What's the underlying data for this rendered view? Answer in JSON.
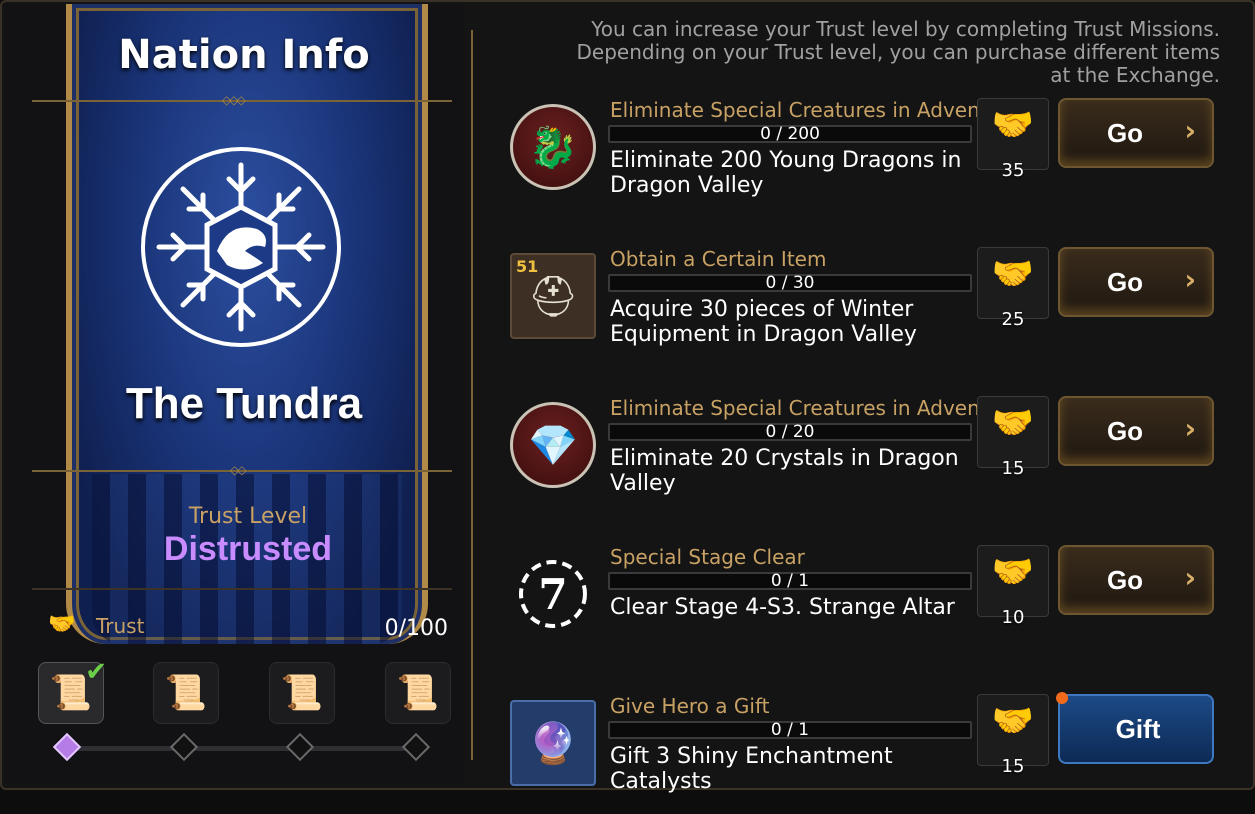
{
  "left": {
    "title": "Nation Info",
    "nation_name": "The Tundra",
    "trust_level_label": "Trust Level",
    "trust_level_value": "Distrusted",
    "trust_label": "Trust",
    "trust_count": "0/100",
    "trust_progress_fraction": 0
  },
  "info_text": "You can increase your Trust level by completing Trust Missions. Depending on your Trust level, you can purchase different items at the Exchange.",
  "missions": [
    {
      "category": "Eliminate Special Creatures in Adventure",
      "progress": "0 / 200",
      "description": "Eliminate 200 Young Dragons in Dragon Valley",
      "reward": "35",
      "button": "Go"
    },
    {
      "category": "Obtain a Certain Item",
      "badge": "51",
      "progress": "0 / 30",
      "description": "Acquire 30 pieces of Winter Equipment in Dragon Valley",
      "reward": "25",
      "button": "Go"
    },
    {
      "category": "Eliminate Special Creatures in Adventure",
      "progress": "0 / 20",
      "description": "Eliminate 20 Crystals in Dragon Valley",
      "reward": "15",
      "button": "Go"
    },
    {
      "category": "Special Stage Clear",
      "progress": "0 / 1",
      "description": "Clear Stage 4-S3. Strange Altar",
      "reward": "10",
      "button": "Go"
    },
    {
      "category": "Give Hero a Gift",
      "progress": "0 / 1",
      "description": "Gift 3 Shiny Enchantment Catalysts",
      "reward": "15",
      "button": "Gift"
    }
  ],
  "icons": {
    "trust": "handshake-icon",
    "chevron": "chevron-right-icon",
    "scroll": "scroll-icon",
    "check": "checkmark-icon"
  },
  "colors": {
    "accent_gold": "#c8a164",
    "status_purple": "#c88cff",
    "notif_orange": "#f06a1a"
  }
}
